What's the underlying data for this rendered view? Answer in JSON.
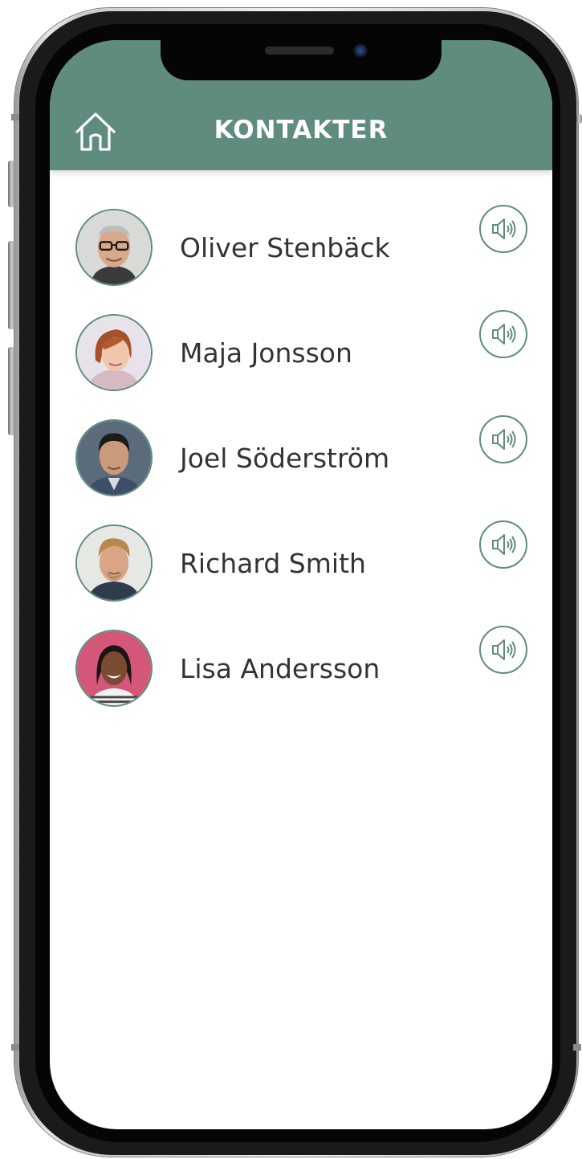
{
  "app": {
    "title": "KONTAKTER",
    "accent_color": "#5f8c7e",
    "home_icon": "home-icon"
  },
  "contacts": [
    {
      "name": "Oliver Stenbäck",
      "avatar": "older-man-glasses-photo",
      "action_icon": "speaker-icon"
    },
    {
      "name": "Maja Jonsson",
      "avatar": "young-woman-red-hair-photo",
      "action_icon": "speaker-icon"
    },
    {
      "name": "Joel Söderström",
      "avatar": "young-man-dark-hair-photo",
      "action_icon": "speaker-icon"
    },
    {
      "name": "Richard Smith",
      "avatar": "blond-man-photo",
      "action_icon": "speaker-icon"
    },
    {
      "name": "Lisa Andersson",
      "avatar": "smiling-woman-pink-background-photo",
      "action_icon": "speaker-icon"
    }
  ]
}
